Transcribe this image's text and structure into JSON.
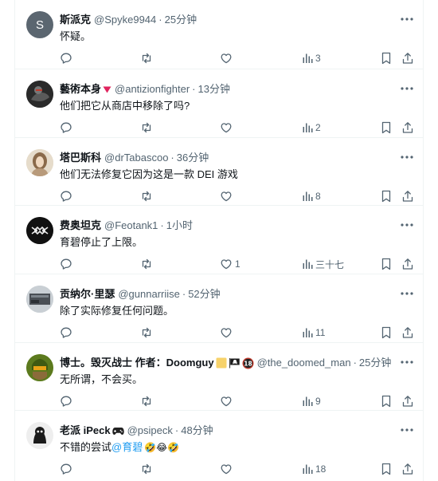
{
  "colors": {
    "accent": "#1d9bf0",
    "muted": "#536471",
    "text": "#0f1419",
    "border": "#eff3f4"
  },
  "icons": {
    "more": "more-icon",
    "reply": "reply-icon",
    "repost": "repost-icon",
    "like": "like-icon",
    "views": "views-icon",
    "bookmark": "bookmark-icon",
    "share": "share-icon"
  },
  "replies": [
    {
      "name": "斯派克",
      "handle": "@Spyke9944",
      "sep": "·",
      "time": "25分钟",
      "text": "怀疑。",
      "likes": "",
      "views": "3",
      "avatar_letter": "S"
    },
    {
      "name": "藝術本身",
      "handle": "@antizionfighter",
      "sep": "·",
      "time": "13分钟",
      "text": "他们把它从商店中移除了吗?",
      "likes": "",
      "views": "2"
    },
    {
      "name": "塔巴斯科",
      "handle": "@drTabascoo",
      "sep": "·",
      "time": "36分钟",
      "text": "他们无法修复它因为这是一款 DEI 游戏",
      "likes": "",
      "views": "8"
    },
    {
      "name": "费奥坦克",
      "handle": "@Feotank1",
      "sep": "·",
      "time": "1小时",
      "text": "育碧停止了上限。",
      "likes": "1",
      "views": "三十七"
    },
    {
      "name": "贡纳尔·里瑟",
      "handle": "@gunnarriise",
      "sep": "·",
      "time": "52分钟",
      "text": "除了实际修复任何问题。",
      "likes": "",
      "views": "11"
    },
    {
      "name": "博士。毁灭战士 作者：Doomguy",
      "handle": "@the_doomed_man",
      "sep": "·",
      "time": "25分钟",
      "text": "无所谓，不会买。",
      "likes": "",
      "views": "9",
      "badge18": "18"
    },
    {
      "name": "老派 iPeck",
      "handle": "@psipeck",
      "sep": "·",
      "time": "48分钟",
      "text": "不错的尝试",
      "mention": "@育碧",
      "emoji": "🤣😂🤣",
      "likes": "",
      "views": "18"
    }
  ]
}
